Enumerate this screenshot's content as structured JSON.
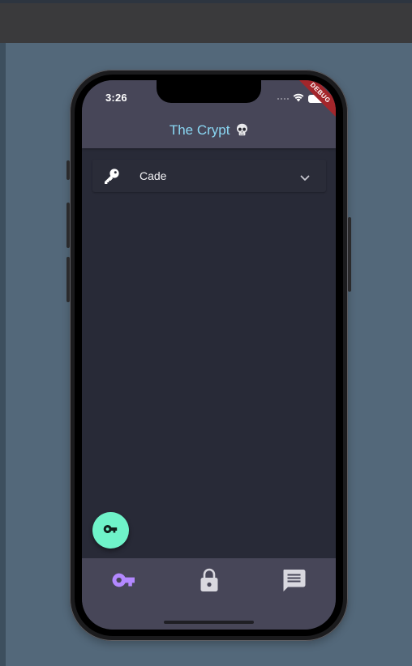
{
  "status_bar": {
    "time": "3:26",
    "debug_banner": "DEBUG"
  },
  "header": {
    "title": "The Crypt",
    "title_emoji_icon": "skull-icon",
    "title_color": "#8ad7f3",
    "background_color": "#474658"
  },
  "keys": [
    {
      "name": "Cade",
      "icon": "key-icon",
      "expand_icon": "chevron-down-icon",
      "expanded": false
    }
  ],
  "fab": {
    "icon": "vpn-key-icon",
    "color": "#6ff3c9"
  },
  "bottom_nav": {
    "items": [
      {
        "icon": "vpn-key-icon",
        "selected": true
      },
      {
        "icon": "lock-icon",
        "selected": false
      },
      {
        "icon": "message-icon",
        "selected": false
      }
    ],
    "selected_color": "#b388ff",
    "unselected_color": "#d9d8df"
  },
  "colors": {
    "background": "#282a37",
    "page_backdrop": "#53687a"
  }
}
